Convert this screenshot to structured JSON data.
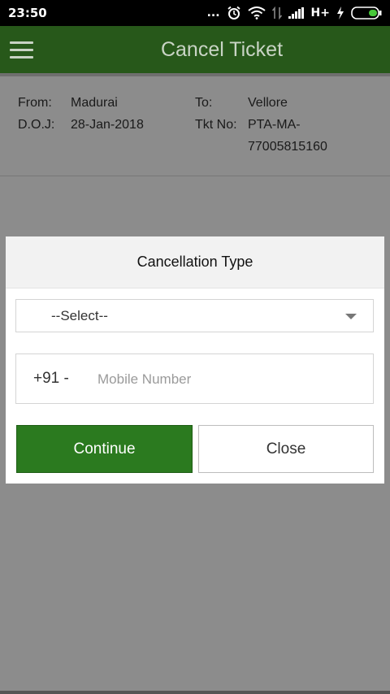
{
  "status_bar": {
    "time": "23:50",
    "dots": "...",
    "network": "H+"
  },
  "header": {
    "title": "Cancel Ticket"
  },
  "trip": {
    "from_label": "From:",
    "from_value": "Madurai",
    "to_label": "To:",
    "to_value": "Vellore",
    "doj_label": "D.O.J:",
    "doj_value": "28-Jan-2018",
    "tkt_label": "Tkt No:",
    "tkt_value_line1": "PTA-MA-",
    "tkt_value_line2": "77005815160"
  },
  "dialog": {
    "title": "Cancellation Type",
    "select_value": "--Select--",
    "phone_prefix": "+91 -",
    "mobile_placeholder": "Mobile Number",
    "continue_label": "Continue",
    "close_label": "Close"
  },
  "colors": {
    "app_bar": "#27581a",
    "continue_button": "#2b7a1f",
    "overlay": "#8c8c8c"
  }
}
